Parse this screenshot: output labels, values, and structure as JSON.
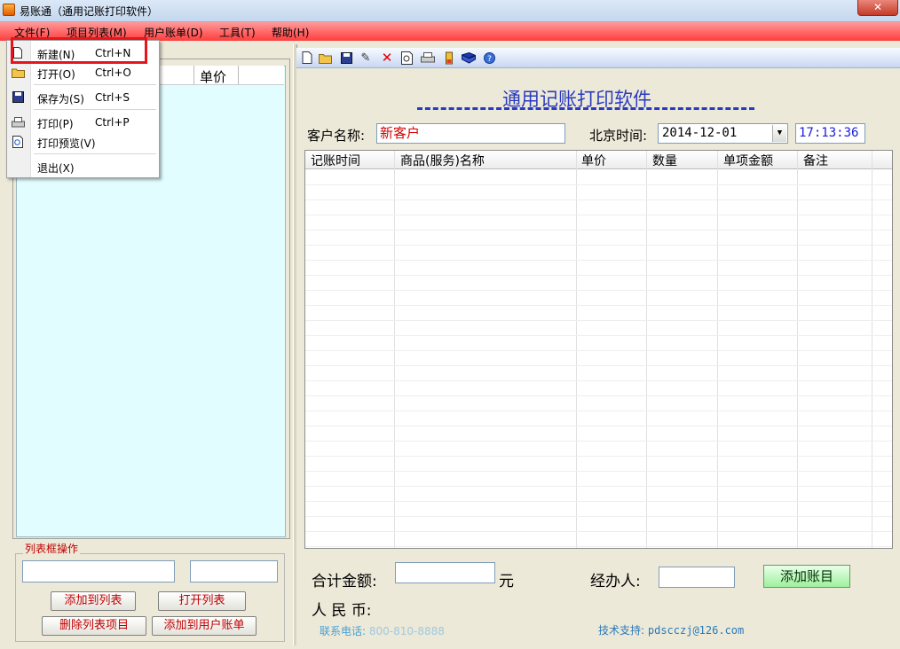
{
  "window": {
    "title": "易账通（通用记账打印软件）",
    "close": "✕"
  },
  "menubar": {
    "items": [
      "文件(F)",
      "项目列表(M)",
      "用户账单(D)",
      "工具(T)",
      "帮助(H)"
    ]
  },
  "file_menu": {
    "items": [
      {
        "label": "新建(N)",
        "shortcut": "Ctrl+N",
        "icon": "new-doc-icon"
      },
      {
        "label": "打开(O)",
        "shortcut": "Ctrl+O",
        "icon": "open-folder-icon"
      },
      {
        "label": "保存为(S)",
        "shortcut": "Ctrl+S",
        "icon": "save-icon"
      },
      {
        "label": "打印(P)",
        "shortcut": "Ctrl+P",
        "icon": "print-icon"
      },
      {
        "label": "打印预览(V)",
        "shortcut": "",
        "icon": "print-preview-icon"
      },
      {
        "label": "退出(X)",
        "shortcut": "",
        "icon": ""
      }
    ]
  },
  "left_panel": {
    "list_header_price": "单价",
    "ops_title": "列表框操作",
    "buttons": {
      "add_to_list": "添加到列表",
      "open_list": "打开列表",
      "delete_item": "删除列表项目",
      "add_to_bill": "添加到用户账单"
    }
  },
  "toolbar": {
    "icons": [
      "new-icon",
      "open-icon",
      "save-icon",
      "stamp-icon",
      "delete-icon",
      "preview-icon",
      "print-icon",
      "battery-icon",
      "book-icon",
      "help-icon"
    ]
  },
  "document": {
    "title": "通用记账打印软件",
    "customer_label": "客户名称:",
    "customer_value": "新客户",
    "time_label": "北京时间:",
    "date_value": "2014-12-01",
    "time_value": "17:13:36",
    "columns": [
      "记账时间",
      "商品(服务)名称",
      "单价",
      "数量",
      "单项金额",
      "备注"
    ],
    "total_label": "合计金额:",
    "total_unit": "元",
    "rmb_label": "人 民 币:",
    "handler_label": "经办人:",
    "add_entry": "添加账目",
    "phone_label": "联系电话:",
    "phone_value": "800-810-8888",
    "support_label": "技术支持:",
    "support_email": "pdscczj@126.com"
  },
  "colors": {
    "menubar": "#ff3d3d",
    "title_blue": "#2a3ac0",
    "button_text": "#c00000",
    "list_bg": "#e2fdff"
  }
}
